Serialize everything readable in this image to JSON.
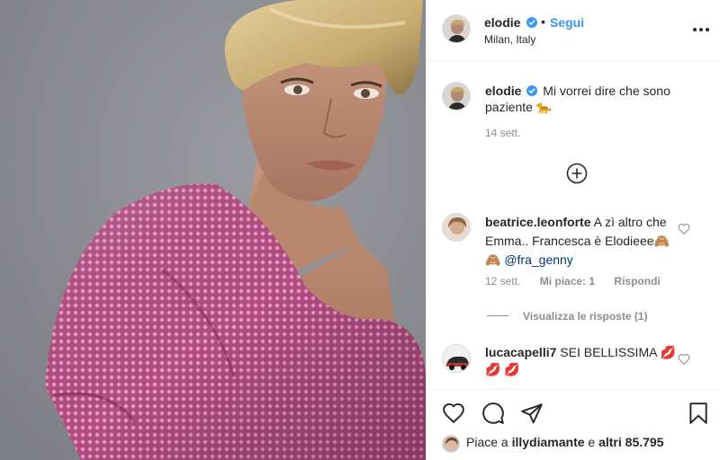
{
  "post": {
    "author": {
      "username": "elodie",
      "verified": true,
      "follow_label": "Segui",
      "separator": "•",
      "location": "Milan, Italy"
    },
    "caption": {
      "username": "elodie",
      "text": "Mi vorrei dire che sono paziente 🐆",
      "time": "14 sett."
    },
    "comments": [
      {
        "username": "beatrice.leonforte",
        "text": "A zì altro che Emma.. Francesca è Elodieee🙈 🙈",
        "mention": "@fra_genny",
        "time": "12 sett.",
        "likes_label": "Mi piace: 1",
        "reply_label": "Rispondi",
        "view_replies": "Visualizza le risposte (1)"
      },
      {
        "username": "lucacapelli7",
        "text": "SEI BELLISSIMA 💋 💋 💋"
      }
    ],
    "likes": {
      "prefix": "Piace a",
      "user": "illydiamante",
      "conj": "e",
      "others": "altri 85.795"
    }
  },
  "icons": {
    "more": "more-options-icon",
    "load_more": "plus-circle-icon",
    "like": "heart-icon",
    "comment": "comment-icon",
    "share": "share-icon",
    "save": "bookmark-icon",
    "verified": "verified-badge-icon"
  },
  "colors": {
    "link": "#3897f0",
    "mention": "#00376b",
    "muted": "#8e8e8e",
    "text": "#262626",
    "dress": "#b8477f"
  }
}
